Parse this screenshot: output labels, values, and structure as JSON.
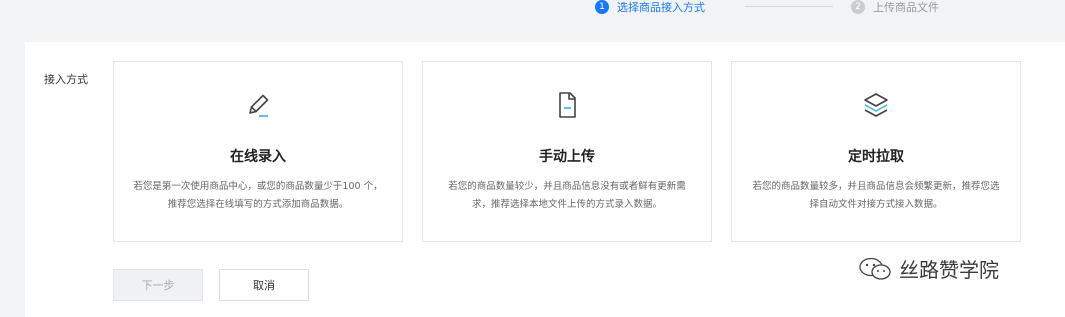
{
  "steps": [
    {
      "number": "1",
      "label": "选择商品接入方式",
      "state": "active"
    },
    {
      "number": "2",
      "label": "上传商品文件",
      "state": "inactive"
    }
  ],
  "form": {
    "field_label": "接入方式"
  },
  "cards": [
    {
      "icon": "pencil-icon",
      "title": "在线录入",
      "description": "若您是第一次使用商品中心，或您的商品数量少于100 个，推荐您选择在线填写的方式添加商品数据。"
    },
    {
      "icon": "document-icon",
      "title": "手动上传",
      "description": "若您的商品数量较少，并且商品信息没有或者鲜有更新需求，推荐选择本地文件上传的方式录入数据。"
    },
    {
      "icon": "layers-icon",
      "title": "定时拉取",
      "description": "若您的商品数量较多，并且商品信息会频繁更新，推荐您选择自动文件对接方式接入数据。"
    }
  ],
  "buttons": {
    "next_label": "下一步",
    "cancel_label": "取消"
  },
  "watermark": {
    "icon": "wechat-icon",
    "text": "丝路赞学院"
  },
  "colors": {
    "accent": "#1677ff",
    "icon_highlight": "#5bc0de"
  }
}
